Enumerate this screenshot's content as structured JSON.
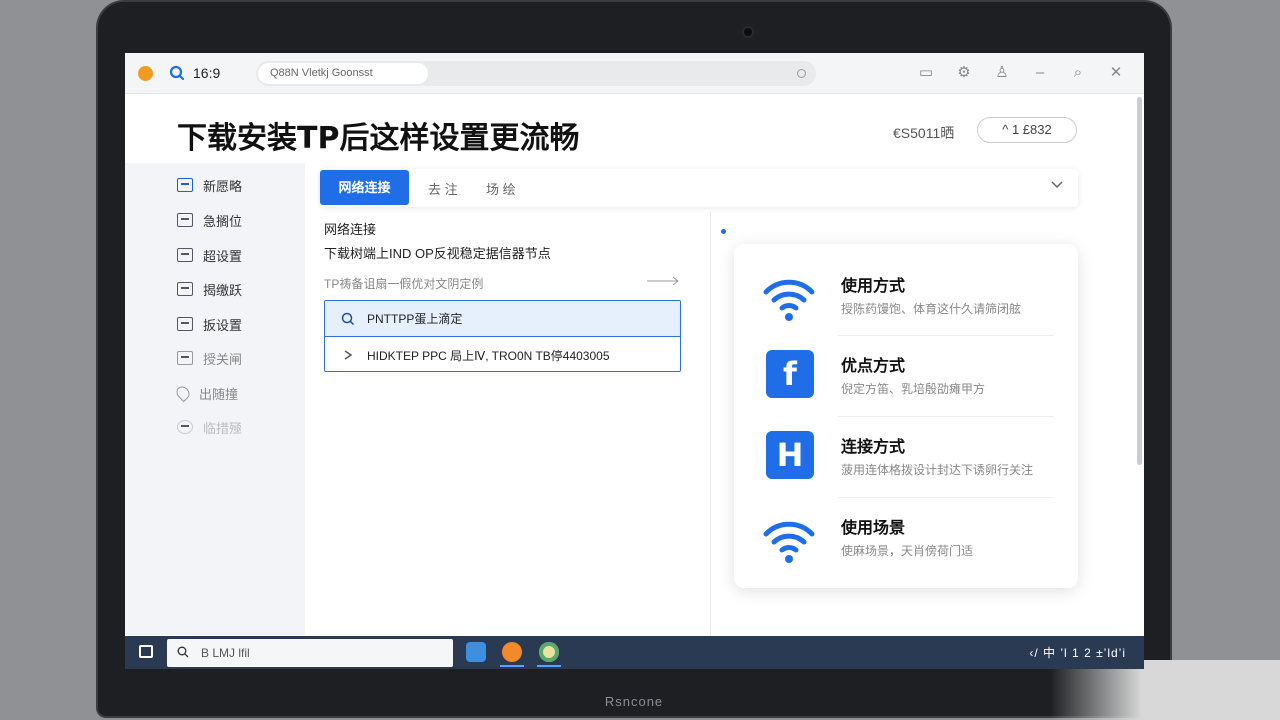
{
  "laptop": {
    "brand_label": "Rsncone"
  },
  "titlebar": {
    "ratio_label": "16:9",
    "url_text": "Q88N Vletkj Goonsst",
    "icons": [
      "chat-icon",
      "gear-icon",
      "user-icon",
      "minimize-icon",
      "search-icon",
      "close-icon"
    ]
  },
  "page": {
    "title": "下载安装TP后这样设置更流畅",
    "meta_left": "€S5011晒",
    "meta_pill": "^ 1 £832"
  },
  "sidebar": {
    "items": [
      {
        "label": "新愿略",
        "state": "active"
      },
      {
        "label": "急搁位",
        "state": "normal"
      },
      {
        "label": "超设置",
        "state": "normal"
      },
      {
        "label": "揭缴跃",
        "state": "normal"
      },
      {
        "label": "扳设置",
        "state": "normal"
      },
      {
        "label": "授关闸",
        "state": "dim"
      },
      {
        "label": "出随撞",
        "state": "dim"
      },
      {
        "label": "临措殛",
        "state": "faint"
      }
    ]
  },
  "tabs": {
    "active": "网络连接",
    "others": [
      "去 注",
      "场 绘"
    ]
  },
  "section": {
    "title": "网络连接",
    "description": "下载树端上IND OP反视稳定据信器节点",
    "hint": "TP祷备诅扇一假优对文阴定例",
    "rows": [
      {
        "icon": "search-icon",
        "text": "PNTTPP蛋上滴定"
      },
      {
        "icon": "chevron-right-icon",
        "text": "HIDKTEP PPC 局上Ⅳ, TRO0N  TB停4403005"
      }
    ]
  },
  "features": [
    {
      "icon": "wifi-icon",
      "name": "使用方式",
      "desc": "授陈药馒饱、体育这什久请筛闭舷"
    },
    {
      "icon": "facebook-icon",
      "glyph": "f",
      "name": "优点方式",
      "desc": "倪定方笛、乳培殷劭瘫甲方"
    },
    {
      "icon": "h-square-icon",
      "glyph": "H",
      "name": "连接方式",
      "desc": "菠用连体格拨设计封达下诱卵行关注"
    },
    {
      "icon": "wifi-icon",
      "name": "使用场景",
      "desc": "使麻场景，天肖傍荷门适"
    }
  ],
  "taskbar": {
    "search_text": "B LMJ lfil",
    "tray_text": "‹/ 中 ’l 1 2 ±’ld’i"
  },
  "colors": {
    "accent": "#1f6ee8",
    "taskbar": "#2a3a52",
    "window_dot": "#f39a22"
  }
}
